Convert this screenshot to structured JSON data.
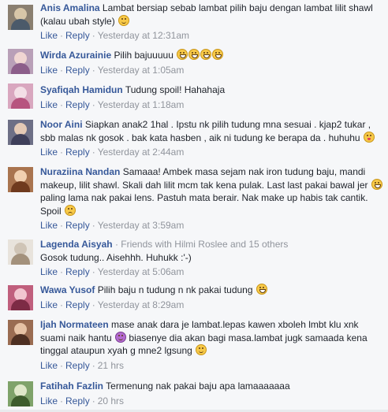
{
  "actions": {
    "like": "Like",
    "reply": "Reply",
    "separator": "·"
  },
  "comments": [
    {
      "author": "Anis Amalina",
      "text": "Lambat bersiap sebab lambat pilih baju dengan lambat lilit shawl (kalau ubah style)",
      "emoji": "slight-smile-emoji",
      "time": "Yesterday at 12:31am",
      "avatar_colors": [
        "#8a7f70",
        "#d8c6a8",
        "#4b5a6a"
      ]
    },
    {
      "author": "Wirda Azurainie",
      "text": "Pilih bajuuuuu",
      "emoji_count": 4,
      "emoji": "grin-emoji",
      "time": "Yesterday at 1:05am",
      "avatar_colors": [
        "#b9a0b8",
        "#f0d6d2",
        "#8c5e8a"
      ]
    },
    {
      "author": "Syafiqah Hamidun",
      "text": "Tudung spoil! Hahahaja",
      "time": "Yesterday at 1:18am",
      "avatar_colors": [
        "#d9a7bf",
        "#f3dfe6",
        "#b7557f"
      ]
    },
    {
      "author": "Noor Aini",
      "text": "Siapkan anak2 1hal . Ipstu nk pilih tudung mna sesuai . kjap2 tukar , sbb malas nk gosok . bak kata hasben , aik ni tudung ke berapa da . huhuhu",
      "emoji": "tongue-emoji",
      "time": "Yesterday at 2:44am",
      "avatar_colors": [
        "#6d6f86",
        "#e4c9b5",
        "#3e3f5a"
      ]
    },
    {
      "author": "Nuraziina Nandan",
      "text": "Samaaa! Ambek masa sejam nak iron tudung baju, mandi makeup, lilit shawl. Skali dah lilit mcm tak kena pulak. Last last pakai bawal jer",
      "text2": "paling lama nak pakai lens. Pastuh mata berair. Nak make up habis tak cantik. Spoil",
      "emoji": "cry-emoji",
      "time": "Yesterday at 3:59am",
      "avatar_colors": [
        "#a9744f",
        "#f1d0b0",
        "#6f3a1e"
      ]
    },
    {
      "author": "Lagenda Aisyah",
      "friends": "· Friends with Hilmi Roslee and 15 others",
      "text": "Gosok tudung.. Aisehhh. Huhukk :'-)",
      "time": "Yesterday at 5:06am",
      "avatar_colors": [
        "#e8e3dc",
        "#cfc4b6",
        "#a3917c"
      ]
    },
    {
      "author": "Wawa Yusof",
      "text": "Pilih baju n tudung n nk pakai tudung",
      "emoji": "laugh-emoji",
      "time": "Yesterday at 8:29am",
      "avatar_colors": [
        "#c05f7d",
        "#f2c6d0",
        "#7d2b45"
      ]
    },
    {
      "author": "Ijah Normateen",
      "text": "mase anak dara je lambat.lepas kawen xboleh lmbt klu xnk suami naik hantu",
      "text2": "biasenye dia akan bagi masa.lambat jugk samaada kena tinggal ataupun xyah g mne2 lgsung",
      "emoji": "devil-emoji",
      "emoji2": "slight-smile-emoji",
      "time": "21 hrs",
      "avatar_colors": [
        "#9a6c52",
        "#e6c2a5",
        "#4d2f22"
      ]
    },
    {
      "author": "Fatihah Fazlin",
      "text": "Termenung nak pakai baju apa lamaaaaaaa",
      "time": "20 hrs",
      "avatar_colors": [
        "#7fa36a",
        "#dfe8c9",
        "#3e5d2d"
      ]
    }
  ]
}
